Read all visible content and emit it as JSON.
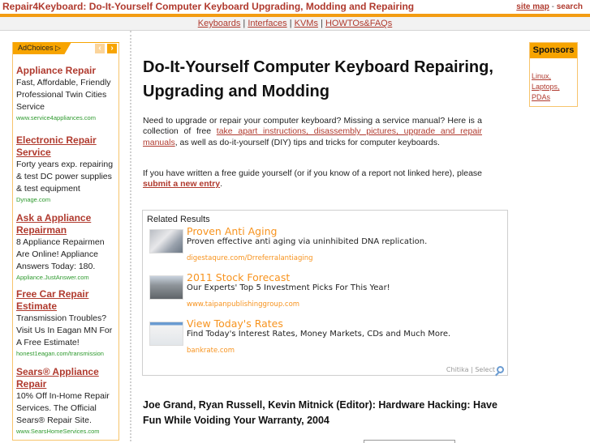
{
  "header": {
    "site_title": "Repair4Keyboard: Do-It-Yourself Computer Keyboard Upgrading, Modding and Repairing",
    "site_map": "site map",
    "separator": "-",
    "search": "search"
  },
  "nav": {
    "items": [
      "Keyboards",
      "Interfaces",
      "KVMs",
      "HOWTOs&FAQs"
    ],
    "pipe": "|"
  },
  "left_ads": {
    "adchoices_label": "AdChoices",
    "adchoices_icon": "▷",
    "prev_icon": "‹",
    "next_icon": "›",
    "ads": [
      {
        "title": "Appliance Repair",
        "desc": "Fast, Affordable, Friendly Professional Twin Cities Service",
        "url": "www.service4appliances.com"
      },
      {
        "title": "Electronic Repair Service",
        "desc": "Forty years exp. repairing & test DC power supplies & test equipment",
        "url": "Dynage.com"
      },
      {
        "title": "Ask a Appliance Repairman",
        "desc": "8 Appliance Repairmen Are Online! Appliance Answers Today: 180.",
        "url": "Appliance.JustAnswer.com"
      },
      {
        "title": "Free Car Repair Estimate",
        "desc": "Transmission Troubles? Visit Us In Eagan MN For A Free Estimate!",
        "url": "honest1eagan.com/transmission"
      },
      {
        "title": "Sears® Appliance Repair",
        "desc": "10% Off In-Home Repair Services. The Official Sears® Repair Site.",
        "url": "www.SearsHomeServices.com"
      }
    ]
  },
  "main": {
    "title": "Do-It-Yourself Computer Keyboard Repairing, Upgrading and Modding",
    "intro_before": "Need to upgrade or repair your computer keyboard? Missing a service manual? Here is a collection of free ",
    "intro_link": "take apart instructions, disassembly pictures, upgrade and repair manuals",
    "intro_after": ", as well as do-it-yourself (DIY) tips and tricks for computer keyboards.",
    "submit_before": "If you have written a free guide yourself (or if you know of a report not linked here), please ",
    "submit_link": "submit a new entry",
    "submit_after": ".",
    "book_title": "Joe Grand, Ryan Russell, Kevin Mitnick (Editor): Hardware Hacking: Have Fun While Voiding Your Warranty, 2004"
  },
  "related": {
    "label": "Related Results",
    "items": [
      {
        "title": "Proven Anti Aging",
        "desc": "Proven effective anti aging via uninhibited DNA replication.",
        "url": "digestaqure.com/Drreferralantiaging"
      },
      {
        "title": "2011 Stock Forecast",
        "desc": "Our Experts' Top 5 Investment Picks For This Year!",
        "url": "www.taipanpublishinggroup.com"
      },
      {
        "title": "View Today's Rates",
        "desc": "Find Today's Interest Rates, Money Markets, CDs and Much More.",
        "url": "bankrate.com"
      }
    ],
    "footer": "Chitika | Select"
  },
  "sponsors": {
    "heading": "Sponsors",
    "links": [
      "Linux,",
      "Laptops,",
      "PDAs"
    ]
  },
  "colors": {
    "brand_red": "#b03a2e",
    "accent_orange": "#f39c12",
    "ad_url_green": "#2e9a2e",
    "related_orange": "#f7931e"
  }
}
